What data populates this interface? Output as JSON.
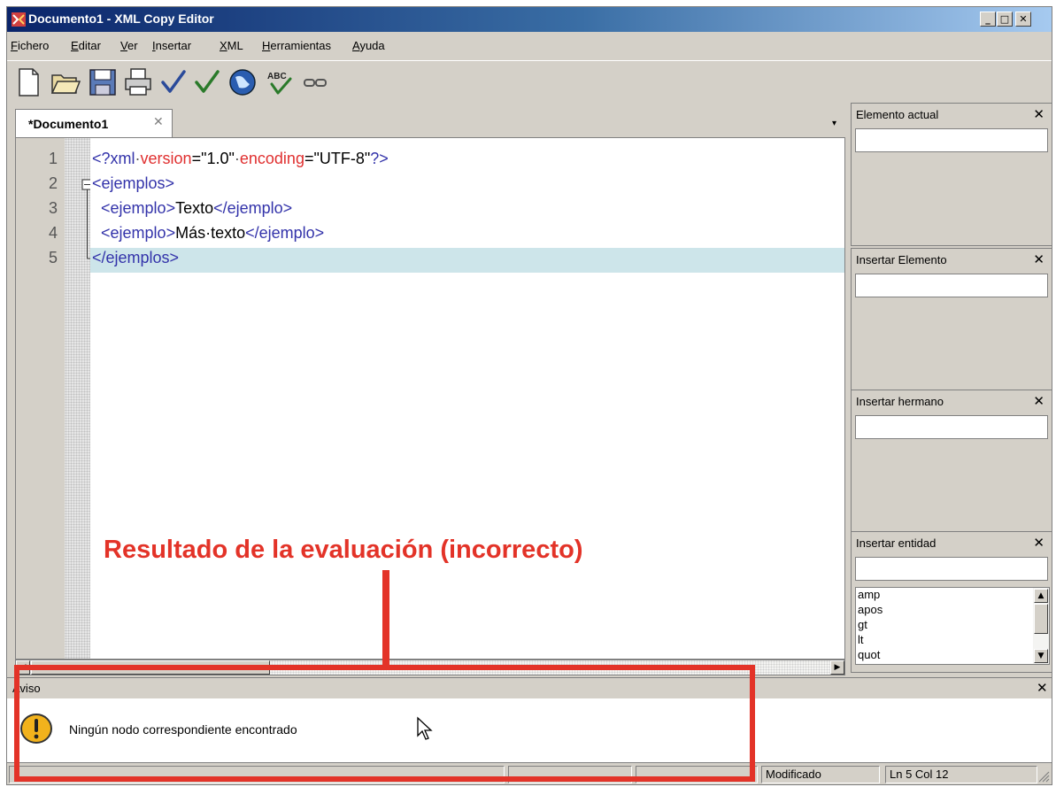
{
  "window": {
    "title": "Documento1 - XML Copy Editor",
    "controls": {
      "minimize": "_",
      "maximize": "□",
      "close": "✕"
    }
  },
  "menu": [
    "Fichero",
    "Editar",
    "Ver",
    "Insertar",
    "XML",
    "Herramientas",
    "Ayuda"
  ],
  "toolbar": [
    "new-document-icon",
    "open-folder-icon",
    "save-icon",
    "print-icon",
    "check-wellformed-icon",
    "validate-icon",
    "browser-icon",
    "spellcheck-icon",
    "link-icon"
  ],
  "tab": {
    "label": "*Documento1",
    "close": "✕",
    "dropdown": "▾"
  },
  "editor": {
    "line_numbers": [
      "1",
      "2",
      "3",
      "4",
      "5"
    ],
    "current_line": 5,
    "lines": [
      {
        "pi_open": "<?",
        "pi_name": "xml",
        "sp1": "·",
        "attr1": "version",
        "eq1": "=",
        "val1": "\"1.0\"",
        "sp2": "·",
        "attr2": "encoding",
        "eq2": "=",
        "val2": "\"UTF-8\"",
        "pi_close": "?>"
      },
      {
        "open": "<ejemplos>"
      },
      {
        "indent": "  ",
        "open": "<ejemplo>",
        "text": "Texto",
        "close": "</ejemplo>"
      },
      {
        "indent": "  ",
        "open": "<ejemplo>",
        "text": "Más·texto",
        "close": "</ejemplo>"
      },
      {
        "close": "</ejemplos>"
      }
    ]
  },
  "panels": {
    "elemento_actual": {
      "title": "Elemento actual",
      "close": "✕"
    },
    "insertar_elemento": {
      "title": "Insertar Elemento",
      "close": "✕"
    },
    "insertar_hermano": {
      "title": "Insertar hermano",
      "close": "✕"
    },
    "insertar_entidad": {
      "title": "Insertar entidad",
      "close": "✕",
      "items": [
        "amp",
        "apos",
        "gt",
        "lt",
        "quot"
      ]
    }
  },
  "aviso": {
    "title": "Aviso",
    "close": "✕",
    "message": "Ningún nodo correspondiente encontrado",
    "icon": "warning-icon"
  },
  "status": {
    "modified": "Modificado",
    "position": "Ln 5 Col 12"
  },
  "annotation": {
    "text": "Resultado de la evaluación (incorrecto)",
    "color": "#e33328"
  },
  "colors": {
    "title_bar": "#0a246a",
    "tag": "#3333aa",
    "attribute": "#e03030",
    "current_line": "#cde5ea"
  }
}
